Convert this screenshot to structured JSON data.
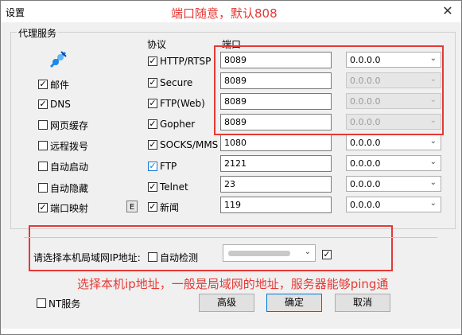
{
  "window": {
    "title": "设置",
    "close_glyph": "✕"
  },
  "annotations": {
    "top": "端口随意，默认808",
    "bottom": "选择本机ip地址，一般是局域网的地址，服务器能够ping通"
  },
  "group": {
    "title": "代理服务"
  },
  "headers": {
    "protocol": "协议",
    "port": "端口"
  },
  "left_options": [
    {
      "label": "邮件",
      "checked": true
    },
    {
      "label": "DNS",
      "checked": true
    },
    {
      "label": "网页缓存",
      "checked": false
    },
    {
      "label": "远程拨号",
      "checked": false
    },
    {
      "label": "自动启动",
      "checked": false
    },
    {
      "label": "自动隐藏",
      "checked": false
    },
    {
      "label": "端口映射",
      "checked": true
    }
  ],
  "e_button": "E",
  "protocols": [
    {
      "label": "HTTP/RTSP",
      "checked": true,
      "port": "8089",
      "bind": "0.0.0.0",
      "bind_enabled": true
    },
    {
      "label": "Secure",
      "checked": true,
      "port": "8089",
      "bind": "0.0.0.0",
      "bind_enabled": false
    },
    {
      "label": "FTP(Web)",
      "checked": true,
      "port": "8089",
      "bind": "0.0.0.0",
      "bind_enabled": false
    },
    {
      "label": "Gopher",
      "checked": true,
      "port": "8089",
      "bind": "0.0.0.0",
      "bind_enabled": false
    },
    {
      "label": "SOCKS/MMS",
      "checked": true,
      "port": "1080",
      "bind": "0.0.0.0",
      "bind_enabled": true
    },
    {
      "label": "FTP",
      "checked": true,
      "port": "2121",
      "bind": "0.0.0.0",
      "bind_enabled": true
    },
    {
      "label": "Telnet",
      "checked": true,
      "port": "23",
      "bind": "0.0.0.0",
      "bind_enabled": true
    },
    {
      "label": "新闻",
      "checked": true,
      "port": "119",
      "bind": "0.0.0.0",
      "bind_enabled": true
    }
  ],
  "ip_section": {
    "label": "请选择本机局域网IP地址:",
    "auto_detect": "自动检测",
    "auto_detect_checked": false,
    "ip_value": "",
    "confirm_checked": true
  },
  "footer": {
    "nt_service": "NT服务",
    "nt_checked": false,
    "advanced": "高级",
    "ok": "确定",
    "cancel": "取消"
  },
  "colors": {
    "annotation": "#e53935",
    "icon": "#1e88e5"
  }
}
